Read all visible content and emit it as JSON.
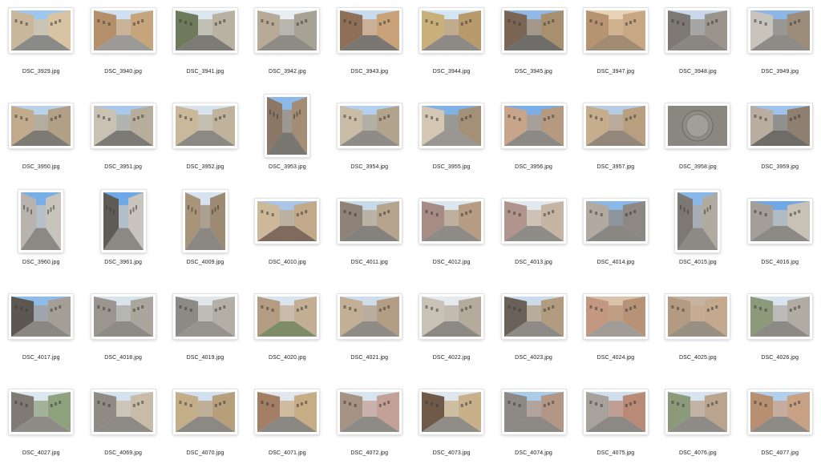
{
  "files": [
    {
      "name": "DSC_3929.jpg",
      "orient": "land",
      "sky": "#9ec7ef",
      "wallL": "#c9b79a",
      "wallR": "#d8c3a2",
      "ground": "#8a8a88"
    },
    {
      "name": "DSC_3940.jpg",
      "orient": "land",
      "sky": "#cfe0f2",
      "wallL": "#b58f6a",
      "wallR": "#c7a57c",
      "ground": "#9b9a96"
    },
    {
      "name": "DSC_3941.jpg",
      "orient": "land",
      "sky": "#dbe7f0",
      "wallL": "#6d7a5c",
      "wallR": "#b9b1a1",
      "ground": "#7d7b76"
    },
    {
      "name": "DSC_3942.jpg",
      "orient": "land",
      "sky": "#e9eef3",
      "wallL": "#b7ab98",
      "wallR": "#a7a394",
      "ground": "#8f8c86"
    },
    {
      "name": "DSC_3943.jpg",
      "orient": "land",
      "sky": "#c7dbee",
      "wallL": "#8f6f57",
      "wallR": "#c9a27a",
      "ground": "#7a7773"
    },
    {
      "name": "DSC_3944.jpg",
      "orient": "land",
      "sky": "#d3e4f3",
      "wallL": "#c9b07a",
      "wallR": "#b89a6c",
      "ground": "#8d8a85"
    },
    {
      "name": "DSC_3945.jpg",
      "orient": "land",
      "sky": "#8fb9e6",
      "wallL": "#7b6656",
      "wallR": "#a88f6d",
      "ground": "#6f6d69"
    },
    {
      "name": "DSC_3947.jpg",
      "orient": "land",
      "sky": "#e7d4b8",
      "wallL": "#b69472",
      "wallR": "#c8a884",
      "ground": "#a28b73"
    },
    {
      "name": "DSC_3948.jpg",
      "orient": "land",
      "sky": "#c9d9ea",
      "wallL": "#7d7873",
      "wallR": "#9a948d",
      "ground": "#8a8783"
    },
    {
      "name": "DSC_3949.jpg",
      "orient": "land",
      "sky": "#8bb6e6",
      "wallL": "#c8c3bb",
      "wallR": "#9c8c7a",
      "ground": "#8e8b86"
    },
    {
      "name": "DSC_3950.jpg",
      "orient": "land",
      "sky": "#b9d2ea",
      "wallL": "#c2ab8d",
      "wallR": "#b19f86",
      "ground": "#7d7a74"
    },
    {
      "name": "DSC_3951.jpg",
      "orient": "land",
      "sky": "#a9c9ec",
      "wallL": "#c9c2b3",
      "wallR": "#b6ad9b",
      "ground": "#7c7a74"
    },
    {
      "name": "DSC_3952.jpg",
      "orient": "land",
      "sky": "#d7e2ec",
      "wallL": "#c9b99a",
      "wallR": "#bfb39e",
      "ground": "#8c8984"
    },
    {
      "name": "DSC_3953.jpg",
      "orient": "port",
      "sky": "#8db9e8",
      "wallL": "#8b7766",
      "wallR": "#a38d74",
      "ground": "#7a7771"
    },
    {
      "name": "DSC_3954.jpg",
      "orient": "land",
      "sky": "#b3d0ee",
      "wallL": "#c8bca6",
      "wallR": "#b2a48c",
      "ground": "#8f8c87"
    },
    {
      "name": "DSC_3955.jpg",
      "orient": "land",
      "sky": "#7fb0e7",
      "wallL": "#d4c8b4",
      "wallR": "#a39077",
      "ground": "#9a9691"
    },
    {
      "name": "DSC_3956.jpg",
      "orient": "land",
      "sky": "#7aaee8",
      "wallL": "#c8a48a",
      "wallR": "#b59a80",
      "ground": "#8d8a86"
    },
    {
      "name": "DSC_3957.jpg",
      "orient": "land",
      "sky": "#b6cce3",
      "wallL": "#c6ad8c",
      "wallR": "#b99f80",
      "ground": "#92877a"
    },
    {
      "name": "DSC_3958.jpg",
      "orient": "square",
      "sky": "#9a9690",
      "wallL": "#8f8b85",
      "wallR": "#a29e98",
      "ground": "#8a8680"
    },
    {
      "name": "DSC_3959.jpg",
      "orient": "land",
      "sky": "#9fc3ea",
      "wallL": "#b9ada0",
      "wallR": "#8e7f70",
      "ground": "#6f6c68"
    },
    {
      "name": "DSC_3960.jpg",
      "orient": "port",
      "sky": "#78aee8",
      "wallL": "#b8b4ad",
      "wallR": "#c8c4bd",
      "ground": "#8c8984"
    },
    {
      "name": "DSC_3961.jpg",
      "orient": "port",
      "sky": "#6ea8e6",
      "wallL": "#5e5a55",
      "wallR": "#c9c5be",
      "ground": "#8c8984"
    },
    {
      "name": "DSC_4009.jpg",
      "orient": "port",
      "sky": "#d6e3ee",
      "wallL": "#a89478",
      "wallR": "#9c8a72",
      "ground": "#8b8883"
    },
    {
      "name": "DSC_4010.jpg",
      "orient": "land",
      "sky": "#a7c6e8",
      "wallL": "#cdb89a",
      "wallR": "#c2a98a",
      "ground": "#7e6b5e"
    },
    {
      "name": "DSC_4011.jpg",
      "orient": "land",
      "sky": "#c8d9ea",
      "wallL": "#8f8276",
      "wallR": "#b6a48d",
      "ground": "#85827d"
    },
    {
      "name": "DSC_4012.jpg",
      "orient": "land",
      "sky": "#dbe6ee",
      "wallL": "#a78c86",
      "wallR": "#b59c82",
      "ground": "#8e8b86"
    },
    {
      "name": "DSC_4013.jpg",
      "orient": "land",
      "sky": "#e2e8ee",
      "wallL": "#b1958d",
      "wallR": "#c7b5a3",
      "ground": "#8f8c87"
    },
    {
      "name": "DSC_4014.jpg",
      "orient": "land",
      "sky": "#8ab8e8",
      "wallL": "#b2aaa0",
      "wallR": "#8d8882",
      "ground": "#8a8782"
    },
    {
      "name": "DSC_4015.jpg",
      "orient": "port",
      "sky": "#88b7e8",
      "wallL": "#7d7871",
      "wallR": "#b1aaa0",
      "ground": "#8d8a85"
    },
    {
      "name": "DSC_4016.jpg",
      "orient": "land",
      "sky": "#6fa8e6",
      "wallL": "#a39f98",
      "wallR": "#c7c1b6",
      "ground": "#8d8a85"
    },
    {
      "name": "DSC_4017.jpg",
      "orient": "land",
      "sky": "#8fbbe9",
      "wallL": "#5c5751",
      "wallR": "#a49e96",
      "ground": "#8a8782"
    },
    {
      "name": "DSC_4018.jpg",
      "orient": "land",
      "sky": "#d8e3ec",
      "wallL": "#9a958e",
      "wallR": "#aaa59d",
      "ground": "#8e8b86"
    },
    {
      "name": "DSC_4019.jpg",
      "orient": "land",
      "sky": "#e1e6ea",
      "wallL": "#8d8a86",
      "wallR": "#b3aea6",
      "ground": "#96938e"
    },
    {
      "name": "DSC_4020.jpg",
      "orient": "land",
      "sky": "#d9e4ee",
      "wallL": "#b39c82",
      "wallR": "#c1ae93",
      "ground": "#7f8c6a"
    },
    {
      "name": "DSC_4021.jpg",
      "orient": "land",
      "sky": "#cfdceb",
      "wallL": "#c2af96",
      "wallR": "#b39e83",
      "ground": "#8f8c87"
    },
    {
      "name": "DSC_4022.jpg",
      "orient": "land",
      "sky": "#e5eaee",
      "wallL": "#c9c2b6",
      "wallR": "#b5ab9d",
      "ground": "#8c8984"
    },
    {
      "name": "DSC_4023.jpg",
      "orient": "land",
      "sky": "#cbdbeb",
      "wallL": "#6b6058",
      "wallR": "#b29c80",
      "ground": "#8e8b86"
    },
    {
      "name": "DSC_4024.jpg",
      "orient": "land",
      "sky": "#d8c4ad",
      "wallL": "#c49880",
      "wallR": "#b89276",
      "ground": "#a19c96"
    },
    {
      "name": "DSC_4025.jpg",
      "orient": "land",
      "sky": "#c5b49f",
      "wallL": "#b49a82",
      "wallR": "#c4a98e",
      "ground": "#9a8f83"
    },
    {
      "name": "DSC_4026.jpg",
      "orient": "land",
      "sky": "#d7e4ee",
      "wallL": "#8a9a7a",
      "wallR": "#b1aca3",
      "ground": "#8d8a85"
    },
    {
      "name": "DSC_4027.jpg",
      "orient": "land",
      "sky": "#dde7ef",
      "wallL": "#7f7a73",
      "wallR": "#8ea27e",
      "ground": "#8f8c87"
    },
    {
      "name": "DSC_4069.jpg",
      "orient": "land",
      "sky": "#d4e2ee",
      "wallL": "#8f8a84",
      "wallR": "#c8bca8",
      "ground": "#8e8b86"
    },
    {
      "name": "DSC_4070.jpg",
      "orient": "land",
      "sky": "#d1e0ee",
      "wallL": "#c4ae8a",
      "wallR": "#b89f7c",
      "ground": "#8c8984"
    },
    {
      "name": "DSC_4071.jpg",
      "orient": "land",
      "sky": "#e1e7ed",
      "wallL": "#a37e64",
      "wallR": "#c6ad86",
      "ground": "#8b8883"
    },
    {
      "name": "DSC_4072.jpg",
      "orient": "land",
      "sky": "#dae4ee",
      "wallL": "#a59486",
      "wallR": "#c4a196",
      "ground": "#8e8b86"
    },
    {
      "name": "DSC_4073.jpg",
      "orient": "land",
      "sky": "#dfe6ec",
      "wallL": "#6f5a4a",
      "wallR": "#c8b08a",
      "ground": "#908d88"
    },
    {
      "name": "DSC_4074.jpg",
      "orient": "land",
      "sky": "#aacbe9",
      "wallL": "#8d8a86",
      "wallR": "#b39786",
      "ground": "#8d8a85"
    },
    {
      "name": "DSC_4075.jpg",
      "orient": "land",
      "sky": "#cfdfee",
      "wallL": "#a7a29c",
      "wallR": "#b98a76",
      "ground": "#8c8984"
    },
    {
      "name": "DSC_4076.jpg",
      "orient": "land",
      "sky": "#d7e3ee",
      "wallL": "#8c9a7c",
      "wallR": "#b9a48d",
      "ground": "#8f8c87"
    },
    {
      "name": "DSC_4077.jpg",
      "orient": "land",
      "sky": "#b2cfec",
      "wallL": "#b98f72",
      "wallR": "#c9a184",
      "ground": "#8e8b86"
    }
  ]
}
